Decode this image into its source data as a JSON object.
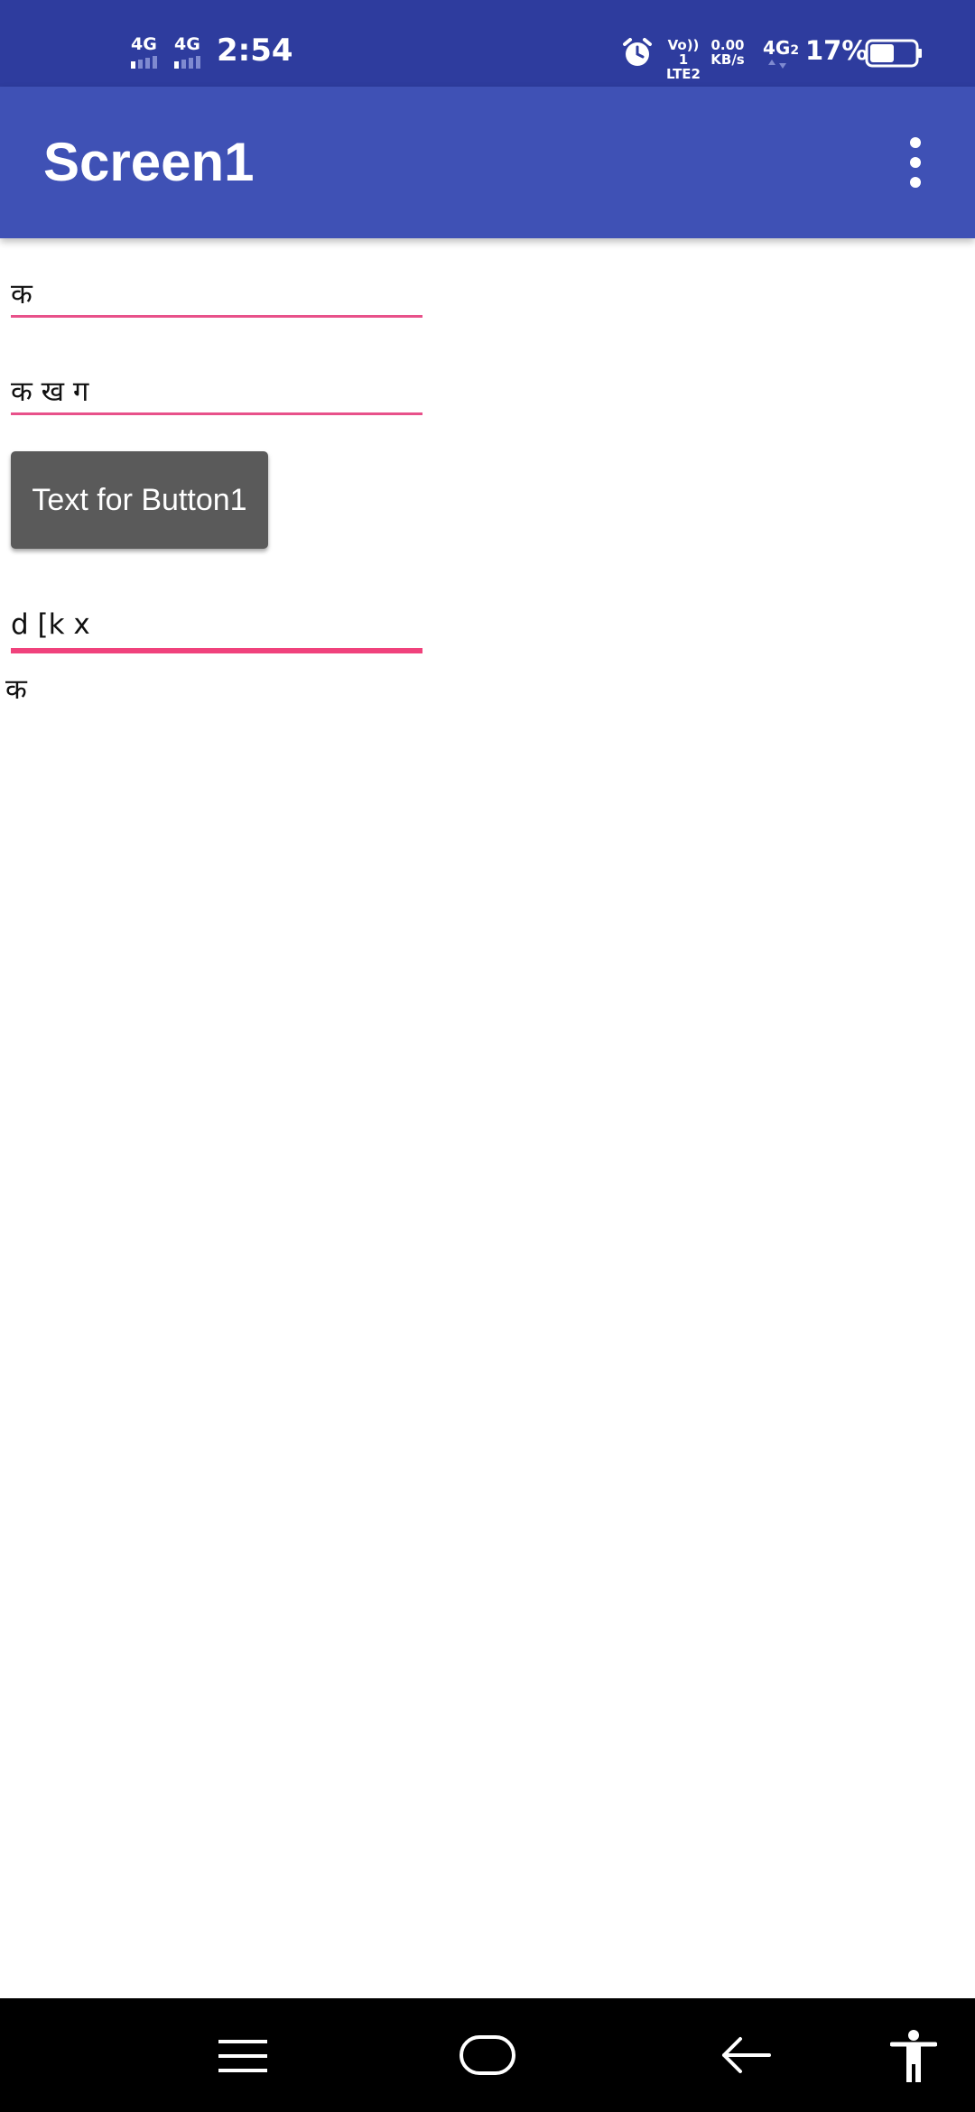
{
  "status_bar": {
    "network_1": "4G",
    "network_2": "4G",
    "time": "2:54",
    "volte_top": "Vo)) 1",
    "volte_bottom": "LTE2",
    "speed_value": "0.00",
    "speed_unit": "KB/s",
    "network_3": "4G",
    "network_3_sub": "2",
    "battery_percent": "17%",
    "battery_level": 0.17,
    "icons": [
      "signal-icon",
      "alarm-icon",
      "volte-icon",
      "battery-icon"
    ]
  },
  "app_bar": {
    "title": "Screen1",
    "menu_icon": "more-vert-icon"
  },
  "content": {
    "textbox1_value": "क",
    "textbox2_value": "क ख ग",
    "button1_label": "Text for Button1",
    "textbox3_value": "d [k x",
    "label1_text": "क"
  },
  "nav_bar": {
    "icons": [
      "menu-icon",
      "home-icon",
      "back-icon",
      "accessibility-icon"
    ]
  },
  "colors": {
    "status_bar": "#2e3c9e",
    "app_bar": "#3f51b5",
    "accent": "#e8518a",
    "button": "#5a5a5a",
    "nav_bar": "#000000"
  }
}
